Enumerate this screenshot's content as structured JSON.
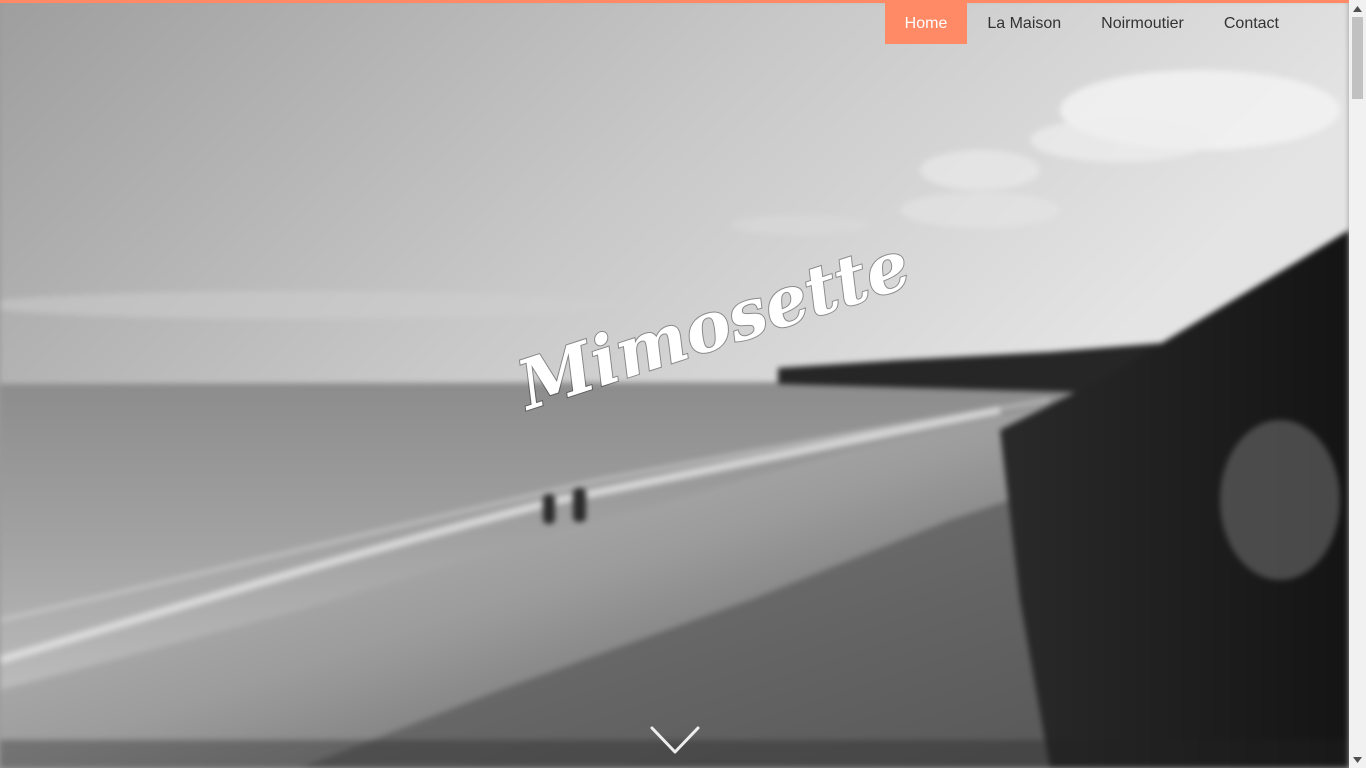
{
  "colors": {
    "accent": "#ff8a65",
    "nav_text": "#333333",
    "nav_active_text": "#ffffff",
    "title": "#ffffff"
  },
  "nav": {
    "items": [
      {
        "label": "Home",
        "active": true
      },
      {
        "label": "La Maison",
        "active": false
      },
      {
        "label": "Noirmoutier",
        "active": false
      },
      {
        "label": "Contact",
        "active": false
      }
    ]
  },
  "hero": {
    "title": "Mimosette",
    "scroll_icon": "chevron-down-icon"
  },
  "scrollbar": {
    "up_icon": "scroll-up-arrow-icon",
    "down_icon": "scroll-down-arrow-icon"
  }
}
